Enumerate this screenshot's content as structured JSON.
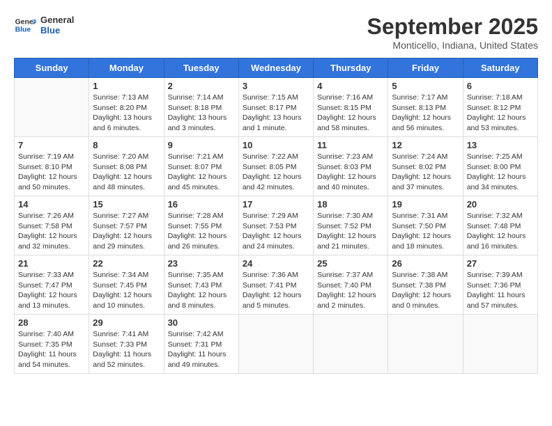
{
  "logo": {
    "name_part1": "General",
    "name_part2": "Blue"
  },
  "header": {
    "month_year": "September 2025",
    "location": "Monticello, Indiana, United States"
  },
  "weekdays": [
    "Sunday",
    "Monday",
    "Tuesday",
    "Wednesday",
    "Thursday",
    "Friday",
    "Saturday"
  ],
  "weeks": [
    [
      {
        "day": "",
        "info": ""
      },
      {
        "day": "1",
        "info": "Sunrise: 7:13 AM\nSunset: 8:20 PM\nDaylight: 13 hours\nand 6 minutes."
      },
      {
        "day": "2",
        "info": "Sunrise: 7:14 AM\nSunset: 8:18 PM\nDaylight: 13 hours\nand 3 minutes."
      },
      {
        "day": "3",
        "info": "Sunrise: 7:15 AM\nSunset: 8:17 PM\nDaylight: 13 hours\nand 1 minute."
      },
      {
        "day": "4",
        "info": "Sunrise: 7:16 AM\nSunset: 8:15 PM\nDaylight: 12 hours\nand 58 minutes."
      },
      {
        "day": "5",
        "info": "Sunrise: 7:17 AM\nSunset: 8:13 PM\nDaylight: 12 hours\nand 56 minutes."
      },
      {
        "day": "6",
        "info": "Sunrise: 7:18 AM\nSunset: 8:12 PM\nDaylight: 12 hours\nand 53 minutes."
      }
    ],
    [
      {
        "day": "7",
        "info": "Sunrise: 7:19 AM\nSunset: 8:10 PM\nDaylight: 12 hours\nand 50 minutes."
      },
      {
        "day": "8",
        "info": "Sunrise: 7:20 AM\nSunset: 8:08 PM\nDaylight: 12 hours\nand 48 minutes."
      },
      {
        "day": "9",
        "info": "Sunrise: 7:21 AM\nSunset: 8:07 PM\nDaylight: 12 hours\nand 45 minutes."
      },
      {
        "day": "10",
        "info": "Sunrise: 7:22 AM\nSunset: 8:05 PM\nDaylight: 12 hours\nand 42 minutes."
      },
      {
        "day": "11",
        "info": "Sunrise: 7:23 AM\nSunset: 8:03 PM\nDaylight: 12 hours\nand 40 minutes."
      },
      {
        "day": "12",
        "info": "Sunrise: 7:24 AM\nSunset: 8:02 PM\nDaylight: 12 hours\nand 37 minutes."
      },
      {
        "day": "13",
        "info": "Sunrise: 7:25 AM\nSunset: 8:00 PM\nDaylight: 12 hours\nand 34 minutes."
      }
    ],
    [
      {
        "day": "14",
        "info": "Sunrise: 7:26 AM\nSunset: 7:58 PM\nDaylight: 12 hours\nand 32 minutes."
      },
      {
        "day": "15",
        "info": "Sunrise: 7:27 AM\nSunset: 7:57 PM\nDaylight: 12 hours\nand 29 minutes."
      },
      {
        "day": "16",
        "info": "Sunrise: 7:28 AM\nSunset: 7:55 PM\nDaylight: 12 hours\nand 26 minutes."
      },
      {
        "day": "17",
        "info": "Sunrise: 7:29 AM\nSunset: 7:53 PM\nDaylight: 12 hours\nand 24 minutes."
      },
      {
        "day": "18",
        "info": "Sunrise: 7:30 AM\nSunset: 7:52 PM\nDaylight: 12 hours\nand 21 minutes."
      },
      {
        "day": "19",
        "info": "Sunrise: 7:31 AM\nSunset: 7:50 PM\nDaylight: 12 hours\nand 18 minutes."
      },
      {
        "day": "20",
        "info": "Sunrise: 7:32 AM\nSunset: 7:48 PM\nDaylight: 12 hours\nand 16 minutes."
      }
    ],
    [
      {
        "day": "21",
        "info": "Sunrise: 7:33 AM\nSunset: 7:47 PM\nDaylight: 12 hours\nand 13 minutes."
      },
      {
        "day": "22",
        "info": "Sunrise: 7:34 AM\nSunset: 7:45 PM\nDaylight: 12 hours\nand 10 minutes."
      },
      {
        "day": "23",
        "info": "Sunrise: 7:35 AM\nSunset: 7:43 PM\nDaylight: 12 hours\nand 8 minutes."
      },
      {
        "day": "24",
        "info": "Sunrise: 7:36 AM\nSunset: 7:41 PM\nDaylight: 12 hours\nand 5 minutes."
      },
      {
        "day": "25",
        "info": "Sunrise: 7:37 AM\nSunset: 7:40 PM\nDaylight: 12 hours\nand 2 minutes."
      },
      {
        "day": "26",
        "info": "Sunrise: 7:38 AM\nSunset: 7:38 PM\nDaylight: 12 hours\nand 0 minutes."
      },
      {
        "day": "27",
        "info": "Sunrise: 7:39 AM\nSunset: 7:36 PM\nDaylight: 11 hours\nand 57 minutes."
      }
    ],
    [
      {
        "day": "28",
        "info": "Sunrise: 7:40 AM\nSunset: 7:35 PM\nDaylight: 11 hours\nand 54 minutes."
      },
      {
        "day": "29",
        "info": "Sunrise: 7:41 AM\nSunset: 7:33 PM\nDaylight: 11 hours\nand 52 minutes."
      },
      {
        "day": "30",
        "info": "Sunrise: 7:42 AM\nSunset: 7:31 PM\nDaylight: 11 hours\nand 49 minutes."
      },
      {
        "day": "",
        "info": ""
      },
      {
        "day": "",
        "info": ""
      },
      {
        "day": "",
        "info": ""
      },
      {
        "day": "",
        "info": ""
      }
    ]
  ]
}
